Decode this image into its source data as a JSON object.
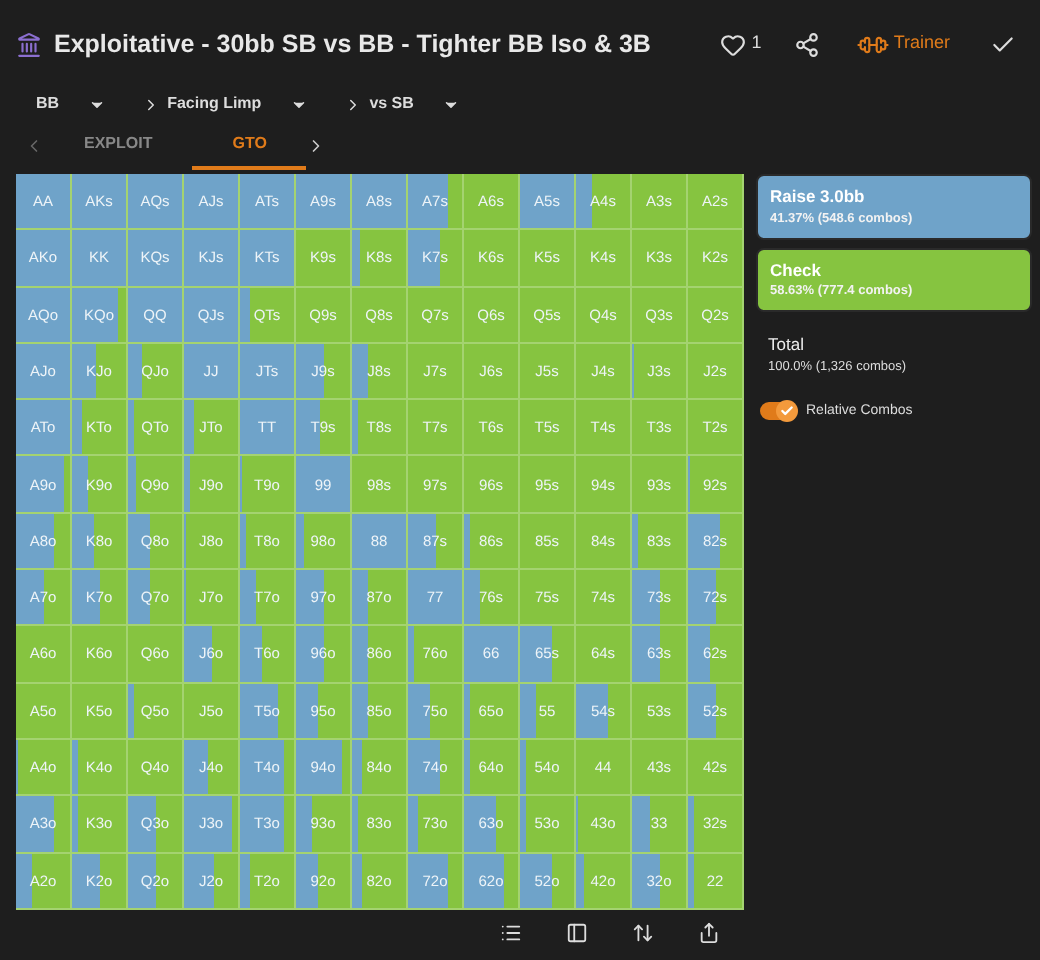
{
  "header": {
    "title": "Exploitative - 30bb SB vs BB - Tighter BB Iso & 3B",
    "likes": "1",
    "trainer": "Trainer"
  },
  "breadcrumb": [
    {
      "label": "BB",
      "chevron": false
    },
    {
      "label": "Facing Limp",
      "chevron": true
    },
    {
      "label": "vs SB",
      "chevron": true
    }
  ],
  "tabs": [
    {
      "label": "EXPLOIT",
      "selected": false
    },
    {
      "label": "GTO",
      "selected": true
    }
  ],
  "grid": [
    [
      "AA",
      "AKs",
      "AQs",
      "AJs",
      "ATs",
      "A9s",
      "A8s",
      "A7s",
      "A6s",
      "A5s",
      "A4s",
      "A3s",
      "A2s"
    ],
    [
      "AKo",
      "KK",
      "KQs",
      "KJs",
      "KTs",
      "K9s",
      "K8s",
      "K7s",
      "K6s",
      "K5s",
      "K4s",
      "K3s",
      "K2s"
    ],
    [
      "AQo",
      "KQo",
      "QQ",
      "QJs",
      "QTs",
      "Q9s",
      "Q8s",
      "Q7s",
      "Q6s",
      "Q5s",
      "Q4s",
      "Q3s",
      "Q2s"
    ],
    [
      "AJo",
      "KJo",
      "QJo",
      "JJ",
      "JTs",
      "J9s",
      "J8s",
      "J7s",
      "J6s",
      "J5s",
      "J4s",
      "J3s",
      "J2s"
    ],
    [
      "ATo",
      "KTo",
      "QTo",
      "JTo",
      "TT",
      "T9s",
      "T8s",
      "T7s",
      "T6s",
      "T5s",
      "T4s",
      "T3s",
      "T2s"
    ],
    [
      "A9o",
      "K9o",
      "Q9o",
      "J9o",
      "T9o",
      "99",
      "98s",
      "97s",
      "96s",
      "95s",
      "94s",
      "93s",
      "92s"
    ],
    [
      "A8o",
      "K8o",
      "Q8o",
      "J8o",
      "T8o",
      "98o",
      "88",
      "87s",
      "86s",
      "85s",
      "84s",
      "83s",
      "82s"
    ],
    [
      "A7o",
      "K7o",
      "Q7o",
      "J7o",
      "T7o",
      "97o",
      "87o",
      "77",
      "76s",
      "75s",
      "74s",
      "73s",
      "72s"
    ],
    [
      "A6o",
      "K6o",
      "Q6o",
      "J6o",
      "T6o",
      "96o",
      "86o",
      "76o",
      "66",
      "65s",
      "64s",
      "63s",
      "62s"
    ],
    [
      "A5o",
      "K5o",
      "Q5o",
      "J5o",
      "T5o",
      "95o",
      "85o",
      "75o",
      "65o",
      "55",
      "54s",
      "53s",
      "52s"
    ],
    [
      "A4o",
      "K4o",
      "Q4o",
      "J4o",
      "T4o",
      "94o",
      "84o",
      "74o",
      "64o",
      "54o",
      "44",
      "43s",
      "42s"
    ],
    [
      "A3o",
      "K3o",
      "Q3o",
      "J3o",
      "T3o",
      "93o",
      "83o",
      "73o",
      "63o",
      "53o",
      "43o",
      "33",
      "32s"
    ],
    [
      "A2o",
      "K2o",
      "Q2o",
      "J2o",
      "T2o",
      "92o",
      "82o",
      "72o",
      "62o",
      "52o",
      "42o",
      "32o",
      "22"
    ]
  ],
  "actions": [
    {
      "name": "Raise 3.0bb",
      "detail": "41.37% (548.6 combos)",
      "color": "#6fa3c9"
    },
    {
      "name": "Check",
      "detail": "58.63% (777.4 combos)",
      "color": "#86c440"
    }
  ],
  "total": {
    "label": "Total",
    "detail": "100.0% (1,326 combos)"
  },
  "toggle": {
    "label": "Relative Combos",
    "on": true
  }
}
